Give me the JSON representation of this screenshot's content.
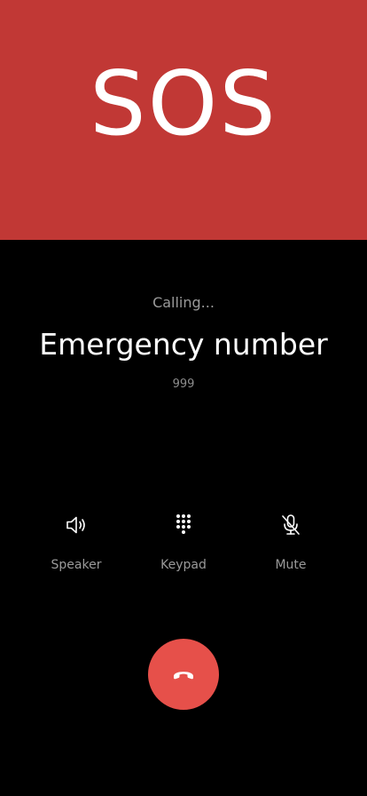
{
  "banner": {
    "text": "SOS",
    "color": "#c13835"
  },
  "call": {
    "status": "Calling...",
    "contact_name": "Emergency number",
    "number": "999"
  },
  "actions": [
    {
      "label": "Speaker",
      "icon": "speaker-icon"
    },
    {
      "label": "Keypad",
      "icon": "keypad-icon"
    },
    {
      "label": "Mute",
      "icon": "mic-off-icon"
    }
  ],
  "end_call": {
    "icon": "phone-hangup-icon",
    "color": "#e6504a"
  }
}
